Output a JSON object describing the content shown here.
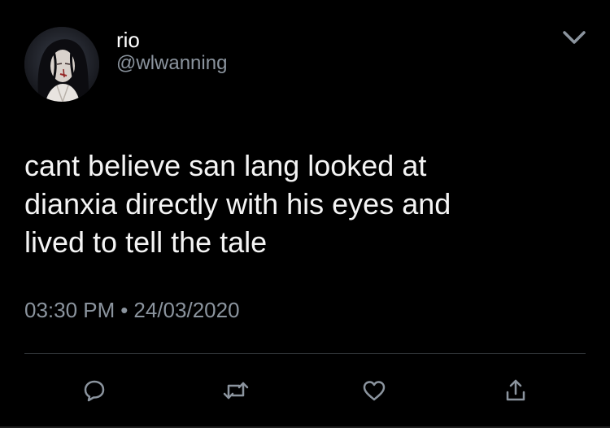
{
  "tweet": {
    "display_name": "rio",
    "handle": "@wlwanning",
    "text_lines": [
      "cant believe san lang looked at",
      "dianxia directly with his eyes and",
      "lived to tell the tale"
    ],
    "time": "03:30 PM",
    "separator": "•",
    "date": "24/03/2020"
  },
  "icons": {
    "menu": "chevron-down-icon",
    "reply": "reply-icon",
    "retweet": "retweet-icon",
    "like": "heart-icon",
    "share": "share-icon"
  },
  "colors": {
    "background": "#000000",
    "primary_text": "#ffffff",
    "secondary_text": "#8b949e",
    "divider": "#2f3336"
  }
}
